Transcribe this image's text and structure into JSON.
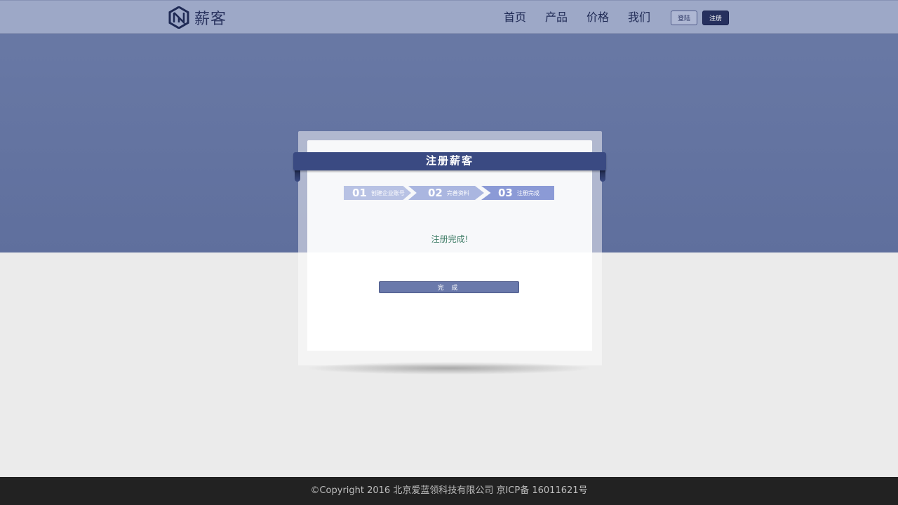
{
  "header": {
    "logo_text": "薪客",
    "nav": [
      "首页",
      "产品",
      "价格",
      "我们"
    ],
    "login_label": "登陆",
    "register_label": "注册"
  },
  "card": {
    "title": "注册薪客",
    "steps": [
      {
        "num": "01",
        "label": "创建企业账号"
      },
      {
        "num": "02",
        "label": "完善资料"
      },
      {
        "num": "03",
        "label": "注册完成"
      }
    ],
    "active_step": 3,
    "message": "注册完成!",
    "complete_button": "完 成"
  },
  "footer": {
    "text": "©Copyright 2016 北京爱蓝领科技有限公司 京ICP备 16011621号"
  },
  "colors": {
    "hero": "#6a7aa6",
    "header": "#9da8c7",
    "accent_dark": "#26305e",
    "ribbon": "#3a4a82",
    "message_green": "#3f7c66",
    "footer": "#222222"
  }
}
